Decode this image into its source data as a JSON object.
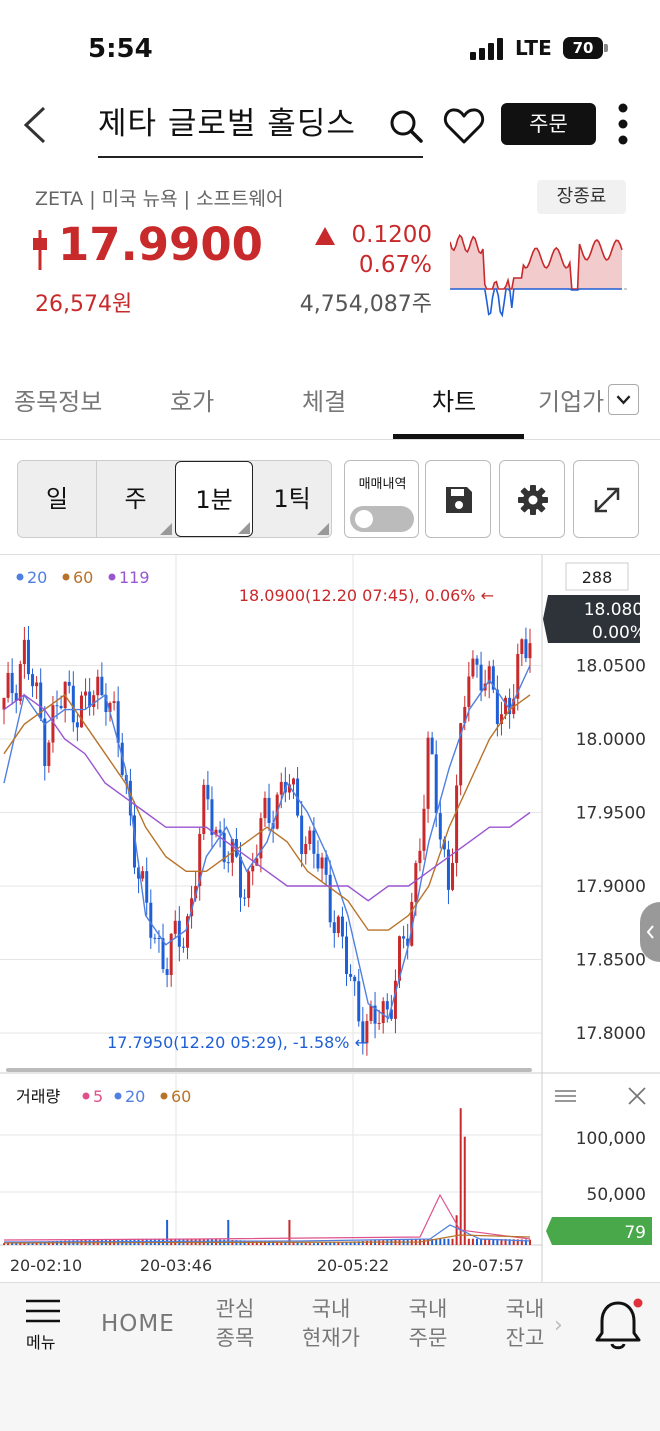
{
  "status_bar": {
    "time": "5:54",
    "network": "LTE",
    "battery": "70"
  },
  "header": {
    "title": "제타 글로벌 홀딩스",
    "order_label": "주문"
  },
  "quote": {
    "meta": "ZETA | 미국 뉴욕 | 소프트웨어",
    "market_status": "장종료",
    "price": "17.9900",
    "price_krw": "26,574원",
    "change": "0.1200",
    "change_pct": "0.67%",
    "volume": "4,754,087주",
    "up_color": "#c8292b",
    "down_color": "#1f5fd6"
  },
  "tabs": [
    "종목정보",
    "호가",
    "체결",
    "차트",
    "기업가"
  ],
  "active_tab": "차트",
  "periods": [
    "일",
    "주",
    "1분",
    "1틱"
  ],
  "selected_period": "1분",
  "trade_history_label": "매매내역",
  "chart": {
    "ma_legend": [
      {
        "label": "20",
        "color": "#4f7fe0"
      },
      {
        "label": "60",
        "color": "#b8732a"
      },
      {
        "label": "119",
        "color": "#9a55d0"
      }
    ],
    "count_label": "288",
    "current_price": "18.0800",
    "current_pct": "0.00%",
    "high_annotation": "18.0900(12.20 07:45), 0.06% ←",
    "low_annotation": "17.7950(12.20 05:29), -1.58% ←",
    "volume_title": "거래량",
    "volume_legend": [
      {
        "label": "5",
        "color": "#e0508a"
      },
      {
        "label": "20",
        "color": "#4f7fe0"
      },
      {
        "label": "60",
        "color": "#b8732a"
      }
    ],
    "volume_current": "79",
    "volume_axis": [
      "100,000",
      "50,000"
    ],
    "time_labels": [
      "20-02:10",
      "20-03:46",
      "20-05:22",
      "20-07:57"
    ]
  },
  "chart_data": {
    "type": "line",
    "title": "",
    "ylim": [
      17.78,
      18.1
    ],
    "y_ticks": [
      18.05,
      18.0,
      17.95,
      17.9,
      17.85,
      17.8
    ],
    "x_ticks": [
      "20-02:10",
      "20-03:46",
      "20-05:22",
      "20-07:57"
    ],
    "series": [
      {
        "name": "20",
        "values": [
          17.97,
          18.03,
          18.01,
          18.02,
          18.02,
          18.03,
          17.98,
          17.88,
          17.86,
          17.87,
          17.92,
          17.94,
          17.91,
          17.93,
          17.97,
          17.95,
          17.92,
          17.88,
          17.82,
          17.81,
          17.86,
          17.93,
          17.98,
          18.02,
          18.04,
          18.02,
          18.05
        ]
      },
      {
        "name": "60",
        "values": [
          17.99,
          18.01,
          18.02,
          18.03,
          18.01,
          17.99,
          17.97,
          17.94,
          17.92,
          17.91,
          17.91,
          17.92,
          17.93,
          17.94,
          17.93,
          17.91,
          17.9,
          17.89,
          17.87,
          17.87,
          17.88,
          17.9,
          17.94,
          17.97,
          18.0,
          18.02,
          18.03
        ]
      },
      {
        "name": "119",
        "values": [
          18.02,
          18.03,
          18.02,
          18.0,
          17.99,
          17.97,
          17.96,
          17.95,
          17.94,
          17.94,
          17.94,
          17.93,
          17.92,
          17.91,
          17.9,
          17.9,
          17.9,
          17.9,
          17.89,
          17.9,
          17.9,
          17.91,
          17.92,
          17.93,
          17.94,
          17.94,
          17.95
        ]
      }
    ],
    "price_values": [
      18.02,
      18.06,
      18.0,
      18.03,
      18.02,
      18.04,
      17.97,
      17.88,
      17.85,
      17.87,
      17.96,
      17.92,
      17.9,
      17.95,
      17.97,
      17.93,
      17.9,
      17.84,
      17.8,
      17.82,
      17.87,
      17.99,
      17.9,
      18.06,
      18.03,
      18.02,
      18.08
    ],
    "volume": {
      "max_marker": 120000,
      "ticks": [
        100000,
        50000
      ]
    }
  }
}
